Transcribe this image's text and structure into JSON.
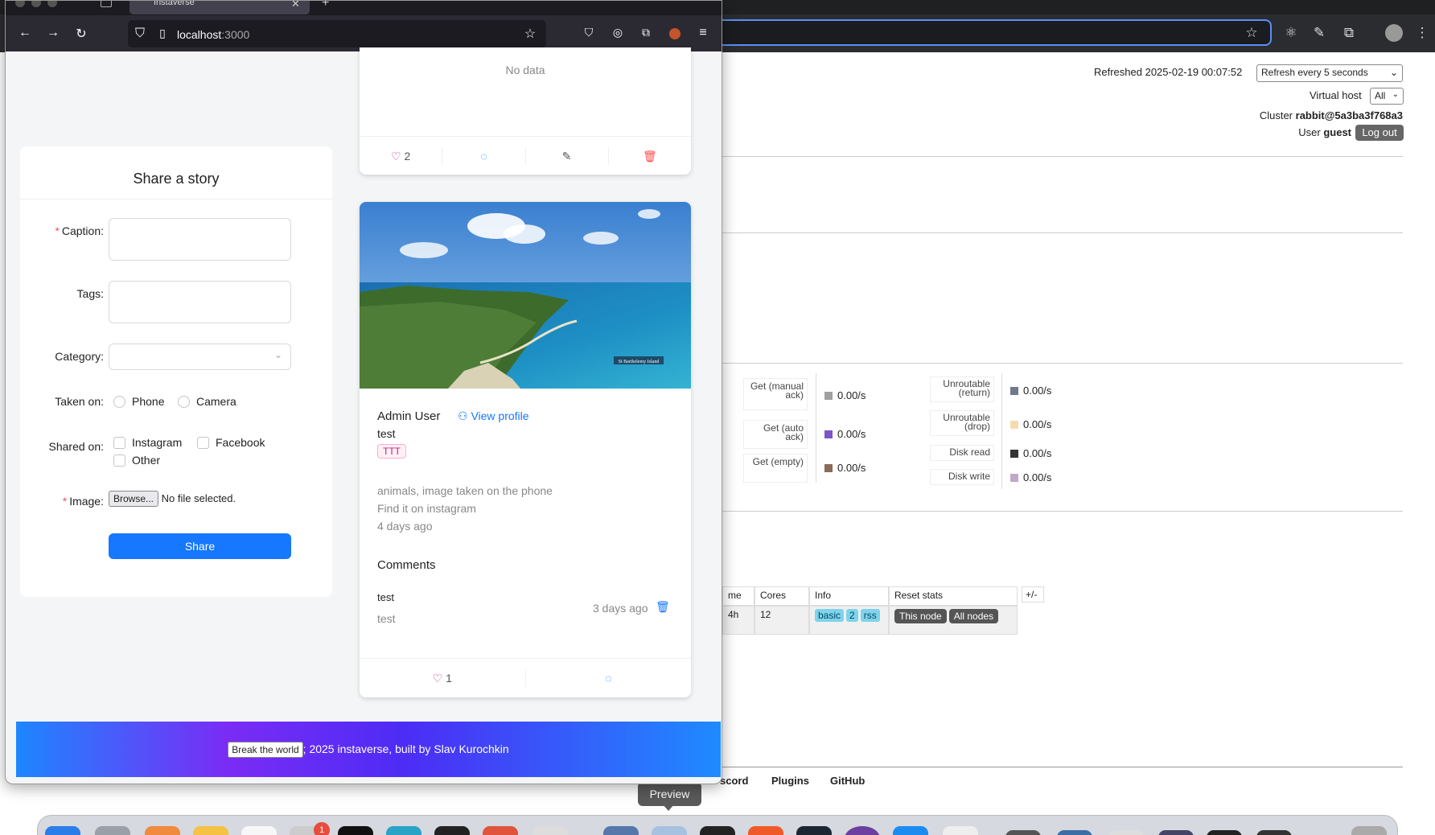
{
  "bg_browser": {
    "refreshed_label": "Refreshed 2025-02-19 00:07:52",
    "refresh_select": "Refresh every 5 seconds",
    "virtual_host_label": "Virtual host",
    "virtual_host_value": "All",
    "cluster_label": "Cluster",
    "cluster_value": "rabbit@5a3ba3f768a3",
    "user_label": "User",
    "user_value": "guest",
    "logout_label": "Log out",
    "rates": [
      {
        "label": "Get (manual ack)",
        "value": "0.00/s",
        "color": "#a0a0a0"
      },
      {
        "label": "Get (auto ack)",
        "value": "0.00/s",
        "color": "#7d55c7"
      },
      {
        "label": "Get (empty)",
        "value": "0.00/s",
        "color": "#8a6a5a"
      },
      {
        "label": "Unroutable (return)",
        "value": "0.00/s",
        "color": "#6e7a8a"
      },
      {
        "label": "Unroutable (drop)",
        "value": "0.00/s",
        "color": "#f5dcb0"
      },
      {
        "label": "Disk read",
        "value": "0.00/s",
        "color": "#333333"
      },
      {
        "label": "Disk write",
        "value": "0.00/s",
        "color": "#c0a8c8"
      }
    ],
    "table": {
      "headers": [
        "me",
        "Cores",
        "Info",
        "Reset stats",
        "+/-"
      ],
      "row": {
        "uptime": "4h",
        "cores": "12",
        "info_pills": [
          "basic",
          "2",
          "rss"
        ],
        "reset_buttons": [
          "This node",
          "All nodes"
        ]
      }
    },
    "footer_links": [
      "scord",
      "Plugins",
      "GitHub"
    ]
  },
  "tooltip": {
    "preview": "Preview"
  },
  "dock": {
    "badge": "1"
  },
  "firefox": {
    "tab_title": "Instaverse",
    "url_host": "localhost",
    "url_port": ":3000"
  },
  "app": {
    "top_card": {
      "no_data": "No data",
      "likes": "2"
    },
    "share_form": {
      "title": "Share a story",
      "caption_label": "Caption",
      "tags_label": "Tags",
      "category_label": "Category",
      "taken_on_label": "Taken on",
      "taken_on_options": [
        "Phone",
        "Camera"
      ],
      "shared_on_label": "Shared on",
      "shared_on_options": [
        "Instagram",
        "Facebook",
        "Other"
      ],
      "image_label": "Image",
      "browse_label": "Browse...",
      "no_file": "No file selected.",
      "share_button": "Share"
    },
    "post": {
      "author": "Admin User",
      "view_profile": "View profile",
      "caption": "test",
      "tag": "TTT",
      "image_watermark": "St Barthelemy Island",
      "meta_category": "animals, image taken on the phone",
      "meta_shared": "Find it on instagram",
      "meta_time": "4 days ago",
      "comments_heading": "Comments",
      "comment": {
        "author": "test",
        "text": "test",
        "time": "3 days ago"
      },
      "likes": "1"
    },
    "footer": {
      "break_button": "Break the world",
      "text": "; 2025 instaverse, built by Slav Kurochkin"
    }
  }
}
